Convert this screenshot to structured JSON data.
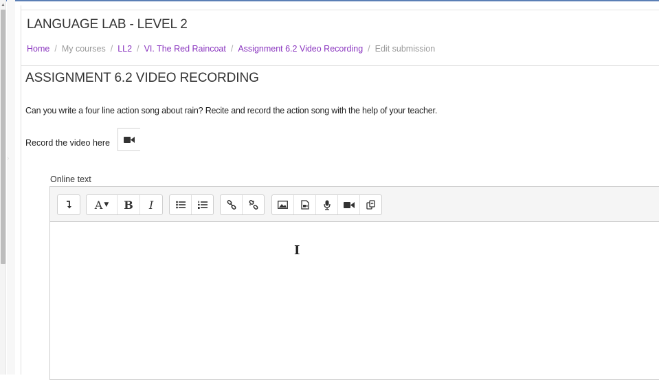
{
  "header": {
    "site_title": "LANGUAGE LAB - LEVEL 2"
  },
  "breadcrumb": [
    {
      "label": "Home",
      "link": true
    },
    {
      "label": "My courses",
      "link": false
    },
    {
      "label": "LL2",
      "link": true
    },
    {
      "label": "VI. The Red Raincoat",
      "link": true
    },
    {
      "label": "Assignment 6.2 Video Recording",
      "link": true
    },
    {
      "label": "Edit submission",
      "link": false
    }
  ],
  "assignment": {
    "title": "ASSIGNMENT 6.2 VIDEO RECORDING",
    "intro": "Can you write a four line action song about rain? Recite and record the action song with the help of your teacher.",
    "record_label": "Record the video here",
    "record_icon": "video-camera-icon"
  },
  "editor": {
    "label": "Online text",
    "content": "",
    "toolbar_icons": [
      "collapse-toggle-icon",
      "font-style-dropdown-icon",
      "bold-icon",
      "italic-icon",
      "unordered-list-icon",
      "ordered-list-icon",
      "link-icon",
      "unlink-icon",
      "insert-image-icon",
      "insert-media-icon",
      "record-audio-icon",
      "record-video-icon",
      "manage-files-icon"
    ],
    "bold_glyph": "B",
    "italic_glyph": "I",
    "font_glyph": "A"
  },
  "colors": {
    "link": "#8a35bf",
    "muted": "#999999",
    "accent_top": "#5b7fb5"
  }
}
